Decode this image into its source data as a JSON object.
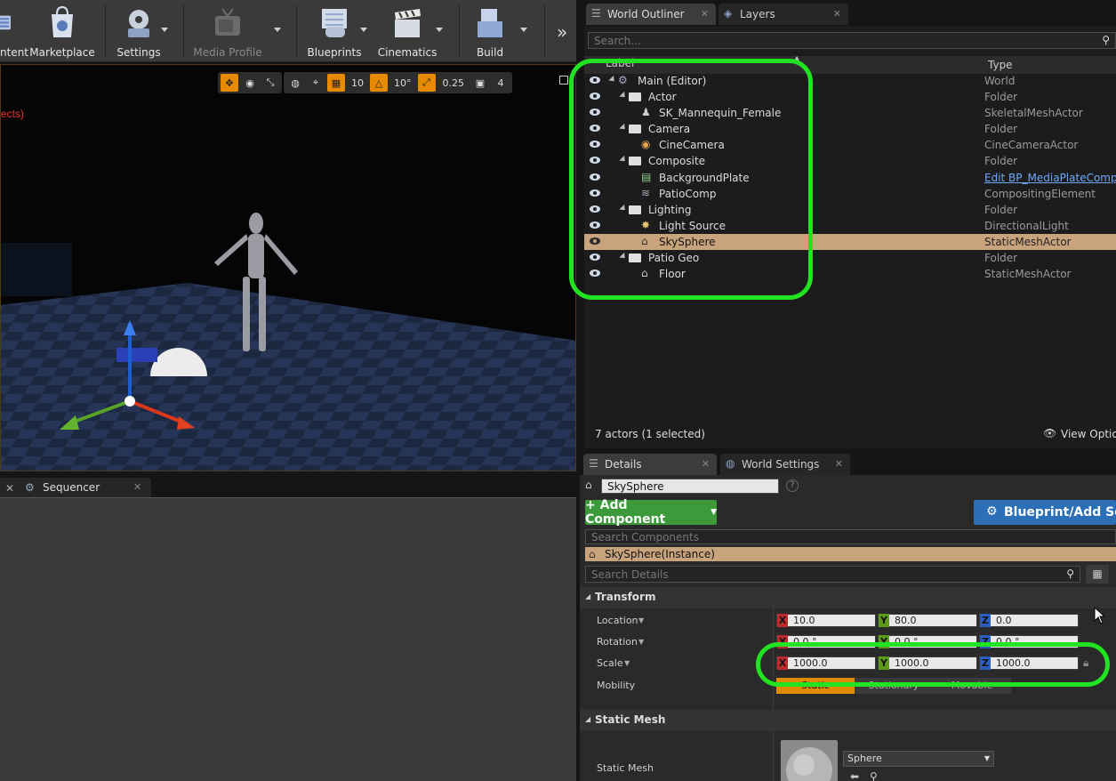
{
  "toolbar": {
    "items": [
      {
        "label": "ntent"
      },
      {
        "label": "Marketplace"
      },
      {
        "label": "Settings"
      },
      {
        "label": "Media Profile"
      },
      {
        "label": "Blueprints"
      },
      {
        "label": "Cinematics"
      },
      {
        "label": "Build"
      }
    ]
  },
  "viewport": {
    "overlay_text": "ects)",
    "grid_snap": "10",
    "rotation_snap": "10°",
    "scale_snap": "0.25",
    "camera_speed": "4"
  },
  "sequencer": {
    "tab_label": "Sequencer"
  },
  "outliner": {
    "tabs": [
      {
        "label": "World Outliner"
      },
      {
        "label": "Layers"
      }
    ],
    "search_placeholder": "Search...",
    "columns": {
      "label": "Label",
      "type": "Type"
    },
    "rows": [
      {
        "label": "Main (Editor)",
        "type": "World"
      },
      {
        "label": "Actor",
        "type": "Folder"
      },
      {
        "label": "SK_Mannequin_Female",
        "type": "SkeletalMeshActor"
      },
      {
        "label": "Camera",
        "type": "Folder"
      },
      {
        "label": "CineCamera",
        "type": "CineCameraActor"
      },
      {
        "label": "Composite",
        "type": "Folder"
      },
      {
        "label": "BackgroundPlate",
        "type": "Edit BP_MediaPlateCompl"
      },
      {
        "label": "PatioComp",
        "type": "CompositingElement"
      },
      {
        "label": "Lighting",
        "type": "Folder"
      },
      {
        "label": "Light Source",
        "type": "DirectionalLight"
      },
      {
        "label": "SkySphere",
        "type": "StaticMeshActor"
      },
      {
        "label": "Patio Geo",
        "type": "Folder"
      },
      {
        "label": "Floor",
        "type": "StaticMeshActor"
      }
    ],
    "status": "7 actors (1 selected)",
    "view_options": "View Option"
  },
  "details": {
    "tabs": [
      {
        "label": "Details"
      },
      {
        "label": "World Settings"
      }
    ],
    "actor_name": "SkySphere",
    "add_component": "+ Add Component",
    "blueprint_button": "Blueprint/Add Scri",
    "search_components_placeholder": "Search Components",
    "instance_label": "SkySphere(Instance)",
    "search_details_placeholder": "Search Details",
    "transform_header": "Transform",
    "location_label": "Location",
    "location": {
      "x": "10.0",
      "y": "80.0",
      "z": "0.0"
    },
    "rotation_label": "Rotation",
    "rotation": {
      "x": "0.0 °",
      "y": "0.0 °",
      "z": "0.0 °"
    },
    "scale_label": "Scale",
    "scale": {
      "x": "1000.0",
      "y": "1000.0",
      "z": "1000.0"
    },
    "mobility_label": "Mobility",
    "mobility_options": [
      "Static",
      "Stationary",
      "Movable"
    ],
    "static_mesh_header": "Static Mesh",
    "static_mesh_label": "Static Mesh",
    "static_mesh_value": "Sphere"
  },
  "colors": {
    "highlight_ring": "#22e322",
    "selection": "#c8a37c",
    "accent_orange": "#e88a00"
  }
}
